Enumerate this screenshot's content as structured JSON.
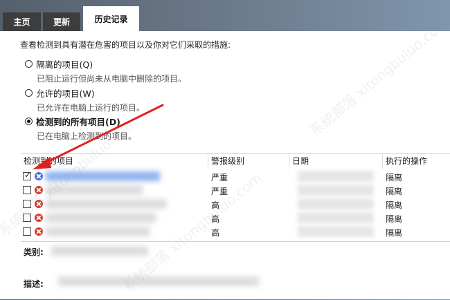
{
  "tabs": [
    {
      "label": "主页",
      "active": false
    },
    {
      "label": "更新",
      "active": false
    },
    {
      "label": "历史记录",
      "active": true
    }
  ],
  "intro": "查看检测到具有潜在危害的项目以及你对它们采取的措施:",
  "options": [
    {
      "label": "隔离的项目(Q)",
      "desc": "已阻止运行但尚未从电脑中删除的项目。",
      "selected": false
    },
    {
      "label": "允许的项目(W)",
      "desc": "已允许在电脑上运行的项目。",
      "selected": false
    },
    {
      "label": "检测到的所有项目(D)",
      "desc": "已在电脑上检测到的项目。",
      "selected": true
    }
  ],
  "table": {
    "columns": [
      "检测到的项目",
      "警报级别",
      "日期",
      "执行的操作"
    ],
    "rows": [
      {
        "checked": true,
        "icon": "blue-threat-icon",
        "level": "严重",
        "action": "隔离"
      },
      {
        "checked": false,
        "icon": "red-threat-icon",
        "level": "严重",
        "action": "隔离"
      },
      {
        "checked": false,
        "icon": "red-threat-icon",
        "level": "高",
        "action": "隔离"
      },
      {
        "checked": false,
        "icon": "red-threat-icon",
        "level": "高",
        "action": "隔离"
      },
      {
        "checked": false,
        "icon": "red-threat-icon",
        "level": "高",
        "action": "隔离"
      }
    ]
  },
  "details": {
    "category_label": "类别:",
    "description_label": "描述:"
  },
  "check_mark": "✓",
  "watermark": "系统部落 xitongbuluo.com",
  "colors": {
    "arrow": "#e02020",
    "tab_dark": "#3d3d3d",
    "threat_red": "#d63a2f"
  }
}
